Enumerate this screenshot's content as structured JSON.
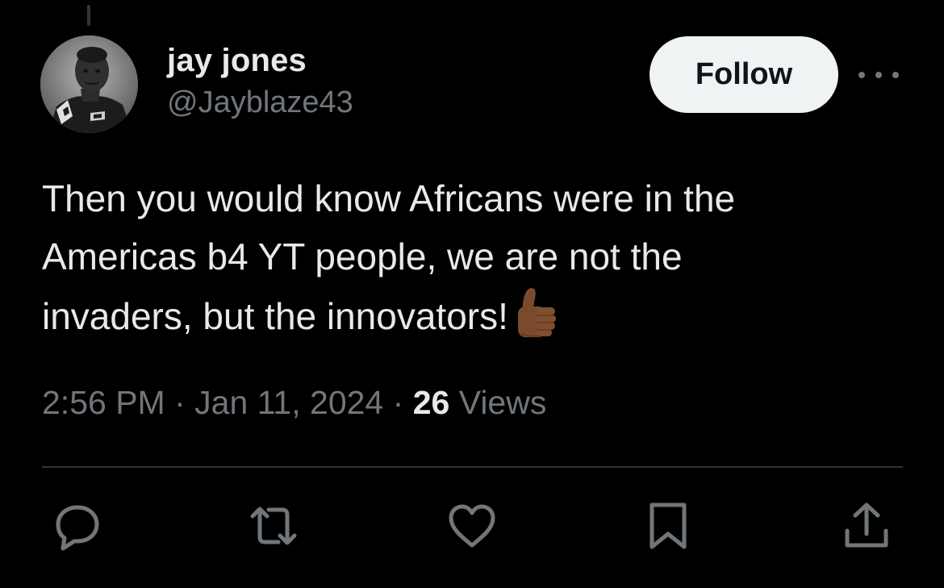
{
  "tweet": {
    "author": {
      "display_name": "jay jones",
      "handle": "@Jayblaze43"
    },
    "follow_label": "Follow",
    "text_lines": [
      "Then you would know Africans were in the",
      "Americas b4 YT people, we are not the",
      "invaders, but the innovators!"
    ],
    "emoji": "thumbs-up-icon (medium-dark skin tone)",
    "time": "2:56 PM",
    "separator": "·",
    "date": "Jan 11, 2024",
    "views_count": "26",
    "views_label": "Views"
  },
  "actions": [
    {
      "name": "reply-icon"
    },
    {
      "name": "repost-icon"
    },
    {
      "name": "like-icon"
    },
    {
      "name": "bookmark-icon"
    },
    {
      "name": "share-icon"
    }
  ],
  "colors": {
    "background": "#000000",
    "primary_text": "#e7e9ea",
    "secondary_text": "#71767b",
    "divider": "#2f3336",
    "follow_bg": "#eff3f4",
    "follow_text": "#0f1419"
  }
}
